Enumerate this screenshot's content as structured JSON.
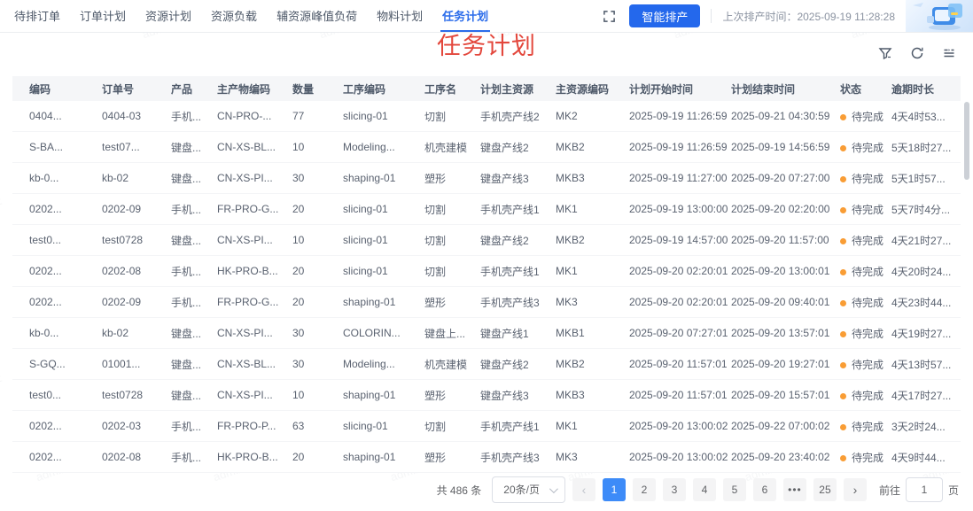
{
  "navbar": {
    "tabs": [
      {
        "label": "待排订单",
        "active": false
      },
      {
        "label": "订单计划",
        "active": false
      },
      {
        "label": "资源计划",
        "active": false
      },
      {
        "label": "资源负载",
        "active": false
      },
      {
        "label": "辅资源峰值负荷",
        "active": false
      },
      {
        "label": "物料计划",
        "active": false
      },
      {
        "label": "任务计划",
        "active": true
      }
    ],
    "smart_schedule_button": "智能排产",
    "last_schedule_label": "上次排产时间：",
    "last_schedule_time": "2025-09-19 11:28:28"
  },
  "page": {
    "title": "任务计划",
    "watermark": "admin2"
  },
  "toolbar": {
    "icons": [
      "filter-icon",
      "refresh-icon",
      "column-settings-icon"
    ]
  },
  "table": {
    "columns": [
      "编码",
      "订单号",
      "产品",
      "主产物编码",
      "数量",
      "工序编码",
      "工序名",
      "计划主资源",
      "主资源编码",
      "计划开始时间",
      "计划结束时间",
      "状态",
      "逾期时长"
    ],
    "status_color": "#f99d35",
    "rows": [
      [
        "0404...",
        "0404-03",
        "手机...",
        "CN-PRO-...",
        "77",
        "slicing-01",
        "切割",
        "手机壳产线2",
        "MK2",
        "2025-09-19 11:26:59",
        "2025-09-21 04:30:59",
        "待完成",
        "4天4时53..."
      ],
      [
        "S-BA...",
        "test07...",
        "键盘...",
        "CN-XS-BL...",
        "10",
        "Modeling...",
        "机壳建模",
        "键盘产线2",
        "MKB2",
        "2025-09-19 11:26:59",
        "2025-09-19 14:56:59",
        "待完成",
        "5天18时27..."
      ],
      [
        "kb-0...",
        "kb-02",
        "键盘...",
        "CN-XS-PI...",
        "30",
        "shaping-01",
        "塑形",
        "键盘产线3",
        "MKB3",
        "2025-09-19 11:27:00",
        "2025-09-20 07:27:00",
        "待完成",
        "5天1时57..."
      ],
      [
        "0202...",
        "0202-09",
        "手机...",
        "FR-PRO-G...",
        "20",
        "slicing-01",
        "切割",
        "手机壳产线1",
        "MK1",
        "2025-09-19 13:00:00",
        "2025-09-20 02:20:00",
        "待完成",
        "5天7时4分..."
      ],
      [
        "test0...",
        "test0728",
        "键盘...",
        "CN-XS-PI...",
        "10",
        "slicing-01",
        "切割",
        "键盘产线2",
        "MKB2",
        "2025-09-19 14:57:00",
        "2025-09-20 11:57:00",
        "待完成",
        "4天21时27..."
      ],
      [
        "0202...",
        "0202-08",
        "手机...",
        "HK-PRO-B...",
        "20",
        "slicing-01",
        "切割",
        "手机壳产线1",
        "MK1",
        "2025-09-20 02:20:01",
        "2025-09-20 13:00:01",
        "待完成",
        "4天20时24..."
      ],
      [
        "0202...",
        "0202-09",
        "手机...",
        "FR-PRO-G...",
        "20",
        "shaping-01",
        "塑形",
        "手机壳产线3",
        "MK3",
        "2025-09-20 02:20:01",
        "2025-09-20 09:40:01",
        "待完成",
        "4天23时44..."
      ],
      [
        "kb-0...",
        "kb-02",
        "键盘...",
        "CN-XS-PI...",
        "30",
        "COLORIN...",
        "键盘上...",
        "键盘产线1",
        "MKB1",
        "2025-09-20 07:27:01",
        "2025-09-20 13:57:01",
        "待完成",
        "4天19时27..."
      ],
      [
        "S-GQ...",
        "01001...",
        "键盘...",
        "CN-XS-BL...",
        "30",
        "Modeling...",
        "机壳建模",
        "键盘产线2",
        "MKB2",
        "2025-09-20 11:57:01",
        "2025-09-20 19:27:01",
        "待完成",
        "4天13时57..."
      ],
      [
        "test0...",
        "test0728",
        "键盘...",
        "CN-XS-PI...",
        "10",
        "shaping-01",
        "塑形",
        "键盘产线3",
        "MKB3",
        "2025-09-20 11:57:01",
        "2025-09-20 15:57:01",
        "待完成",
        "4天17时27..."
      ],
      [
        "0202...",
        "0202-03",
        "手机...",
        "FR-PRO-P...",
        "63",
        "slicing-01",
        "切割",
        "手机壳产线1",
        "MK1",
        "2025-09-20 13:00:02",
        "2025-09-22 07:00:02",
        "待完成",
        "3天2时24..."
      ],
      [
        "0202...",
        "0202-08",
        "手机...",
        "HK-PRO-B...",
        "20",
        "shaping-01",
        "塑形",
        "手机壳产线3",
        "MK3",
        "2025-09-20 13:00:02",
        "2025-09-20 23:40:02",
        "待完成",
        "4天9时44..."
      ]
    ]
  },
  "pagination": {
    "total_label": "共 486 条",
    "page_size": "20条/页",
    "prev": "‹",
    "next": "›",
    "pages": [
      "1",
      "2",
      "3",
      "4",
      "5",
      "6",
      "•••",
      "25"
    ],
    "active_page": "1",
    "goto_label": "前往",
    "goto_value": "1",
    "goto_unit": "页"
  },
  "colors": {
    "accent_blue": "#2468ec",
    "pager_active_blue": "#3d8bf8",
    "title_red": "#e3473c",
    "status_orange": "#f99d35"
  }
}
